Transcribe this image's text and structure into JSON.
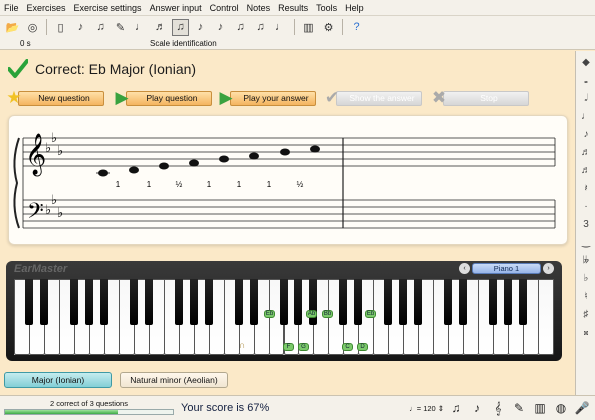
{
  "menu": [
    "File",
    "Exercises",
    "Exercise settings",
    "Answer input",
    "Control",
    "Notes",
    "Results",
    "Tools",
    "Help"
  ],
  "toolbar": {
    "time": "0 s",
    "mode": "Scale identification"
  },
  "result": {
    "text": "Correct: Eb Major (Ionian)"
  },
  "actions": {
    "new_question": "New question",
    "play_question": "Play question",
    "play_answer": "Play your answer",
    "show_answer": "Show the answer",
    "stop": "Stop"
  },
  "staff": {
    "intervals": [
      "1",
      "1",
      "½",
      "1",
      "1",
      "1",
      "½"
    ]
  },
  "keyboard": {
    "title": "EarMaster",
    "instrument": "Piano 1",
    "prev": "‹",
    "next": "›",
    "marks": {
      "eb_first": "Eb",
      "ab": "Ab",
      "bb": "Bb",
      "eb_second": "Eb",
      "f": "F",
      "g": "G",
      "c": "C",
      "d": "D"
    }
  },
  "answers": {
    "option1": "Major (Ionian)",
    "option2": "Natural minor (Aeolian)"
  },
  "status": {
    "progress_text": "2 correct of 3 questions",
    "progress_fraction": 0.67,
    "score_text": "Your score is 67%",
    "tempo": "120"
  },
  "colors": {
    "background": "#fbe9c8",
    "accent_button": "#f4b460",
    "correct_green": "#3eaa47",
    "highlight_key": "#7bc96b"
  }
}
